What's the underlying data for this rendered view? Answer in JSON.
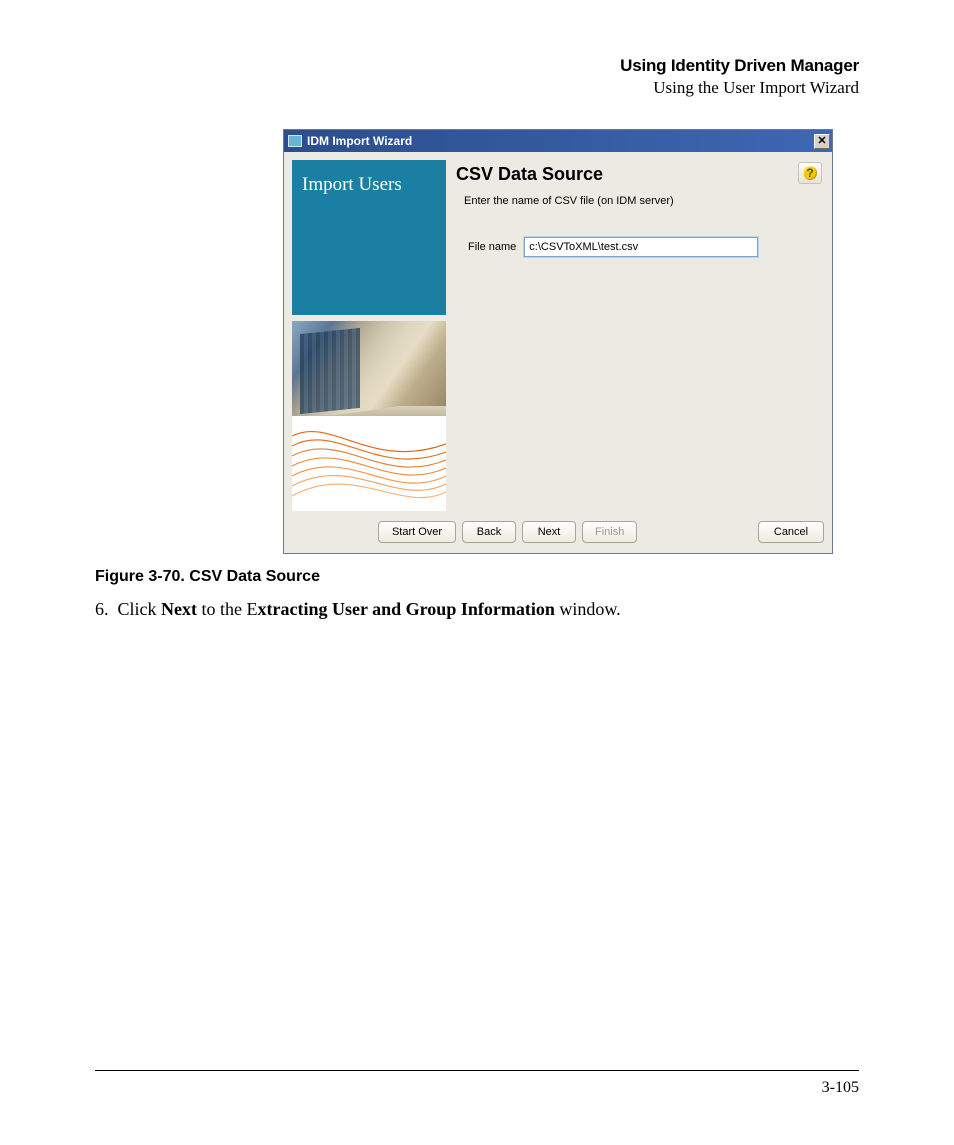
{
  "header": {
    "title": "Using Identity Driven Manager",
    "subtitle": "Using the User Import Wizard"
  },
  "dialog": {
    "window_title": "IDM Import Wizard",
    "sidebar_heading": "Import Users",
    "section_title": "CSV Data Source",
    "section_subtitle": "Enter the name of CSV file (on IDM server)",
    "file_label": "File name",
    "file_value": "c:\\CSVToXML\\test.csv",
    "buttons": {
      "start_over": "Start Over",
      "back": "Back",
      "next": "Next",
      "finish": "Finish",
      "cancel": "Cancel"
    },
    "help_symbol": "?",
    "close_symbol": "✕"
  },
  "caption": {
    "label": "Figure 3-70.",
    "text": " CSV Data Source"
  },
  "step": {
    "num": "6.",
    "pre": "Click ",
    "bold1": "Next",
    "mid": " to the E",
    "bold2": "xtracting User and Group Information",
    "post": " window."
  },
  "page_number": "3-105"
}
